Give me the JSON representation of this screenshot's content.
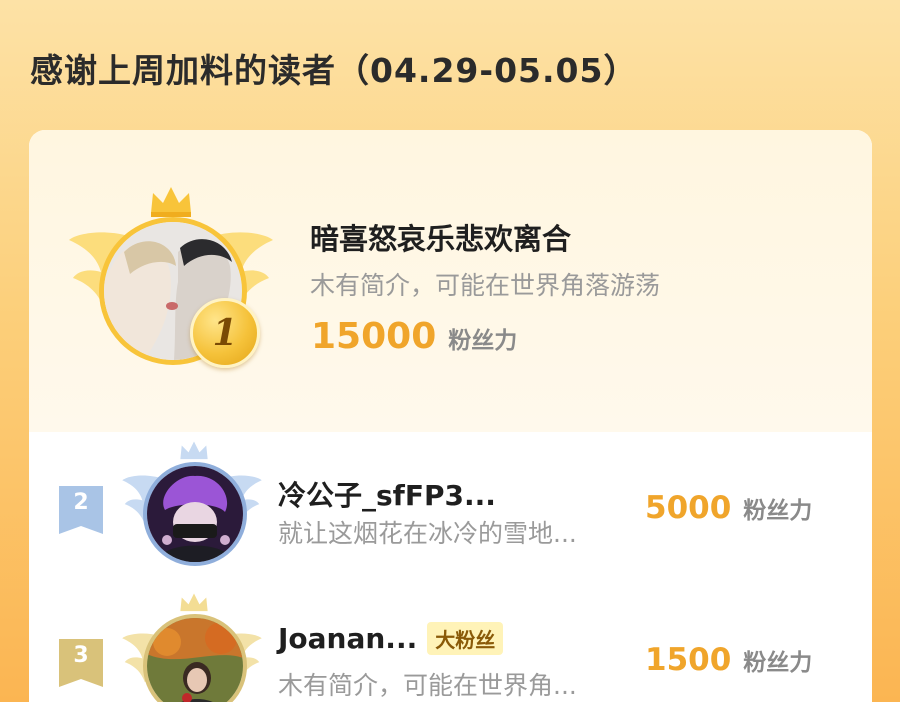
{
  "header": {
    "title": "感谢上周加料的读者（04.29-05.05）"
  },
  "colors": {
    "accent_orange": "#f0a52b",
    "gold": "#f5c23a",
    "silver_blue": "#a9c4e6",
    "bronze": "#d9c27a"
  },
  "leaderboard": {
    "first": {
      "rank": "1",
      "name": "暗喜怒哀乐悲欢离合",
      "bio": "木有简介，可能在世界角落游荡",
      "points": "15000",
      "points_unit": "粉丝力"
    },
    "entries": [
      {
        "rank": "2",
        "name": "冷公子_sfFP3...",
        "bio": "就让这烟花在冰冷的雪地...",
        "points": "5000",
        "points_unit": "粉丝力",
        "tag": ""
      },
      {
        "rank": "3",
        "name": "Joanan...",
        "bio": "木有简介，可能在世界角...",
        "points": "1500",
        "points_unit": "粉丝力",
        "tag": "大粉丝"
      }
    ]
  }
}
